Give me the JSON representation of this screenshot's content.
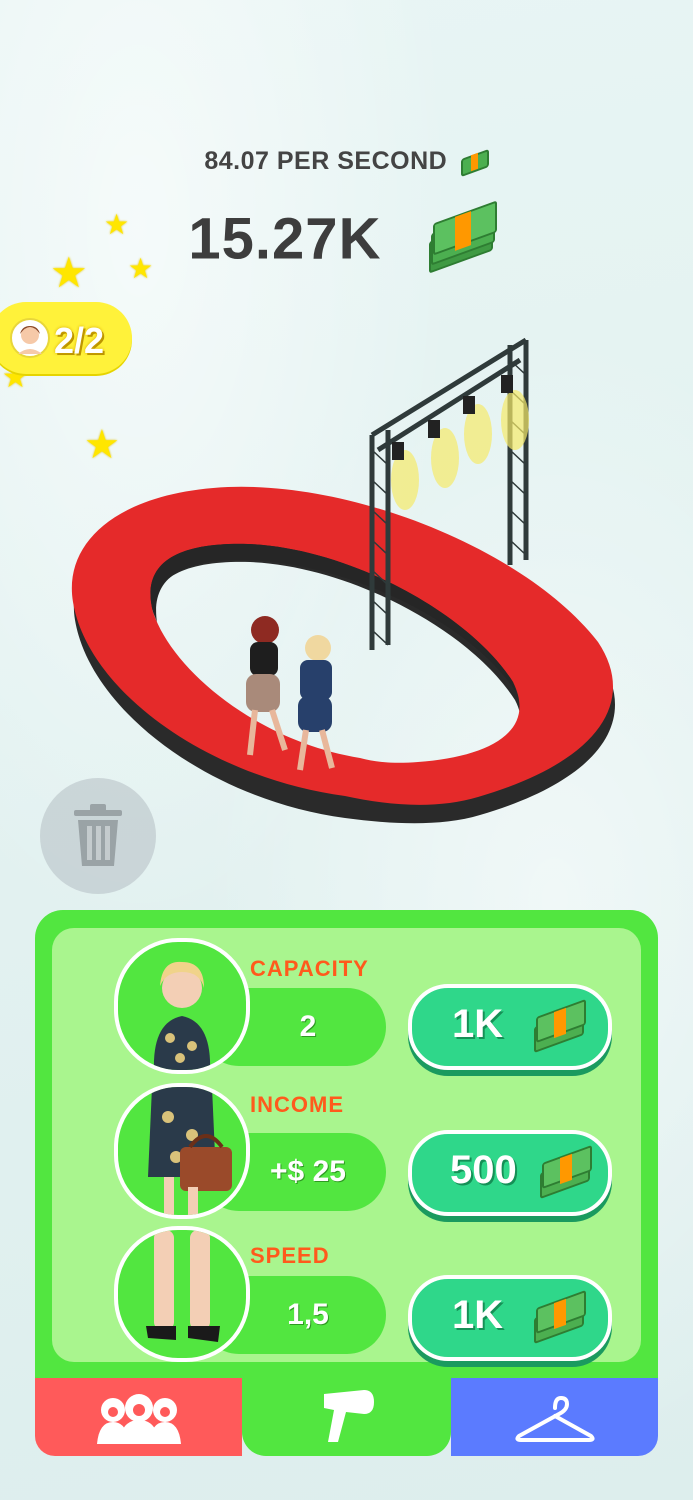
{
  "hud": {
    "per_second": "84.07 PER SECOND",
    "balance": "15.27K"
  },
  "capacity_badge": {
    "text": "2/2",
    "icon": "model-face-icon"
  },
  "trash": {
    "icon": "trash-icon"
  },
  "upgrades": [
    {
      "label": "CAPACITY",
      "value": "2",
      "price": "1K",
      "icon": "cash-stack-icon"
    },
    {
      "label": "INCOME",
      "value": "+$ 25",
      "price": "500",
      "icon": "cash-stack-icon"
    },
    {
      "label": "SPEED",
      "value": "1,5",
      "price": "1K",
      "icon": "cash-stack-icon"
    }
  ],
  "tabs": [
    {
      "name": "models",
      "icon": "models-group-icon",
      "color": "#ff5a5a"
    },
    {
      "name": "styling",
      "icon": "hair-dryer-icon",
      "color": "#52e640"
    },
    {
      "name": "clothes",
      "icon": "hanger-icon",
      "color": "#5b7bff"
    }
  ],
  "colors": {
    "runway": "#e52a2a",
    "panel": "#52e640",
    "panel_inner": "#a9f58e",
    "buy_button": "#2fd78a",
    "label": "#ff5a1c",
    "badge": "#fff23a"
  }
}
